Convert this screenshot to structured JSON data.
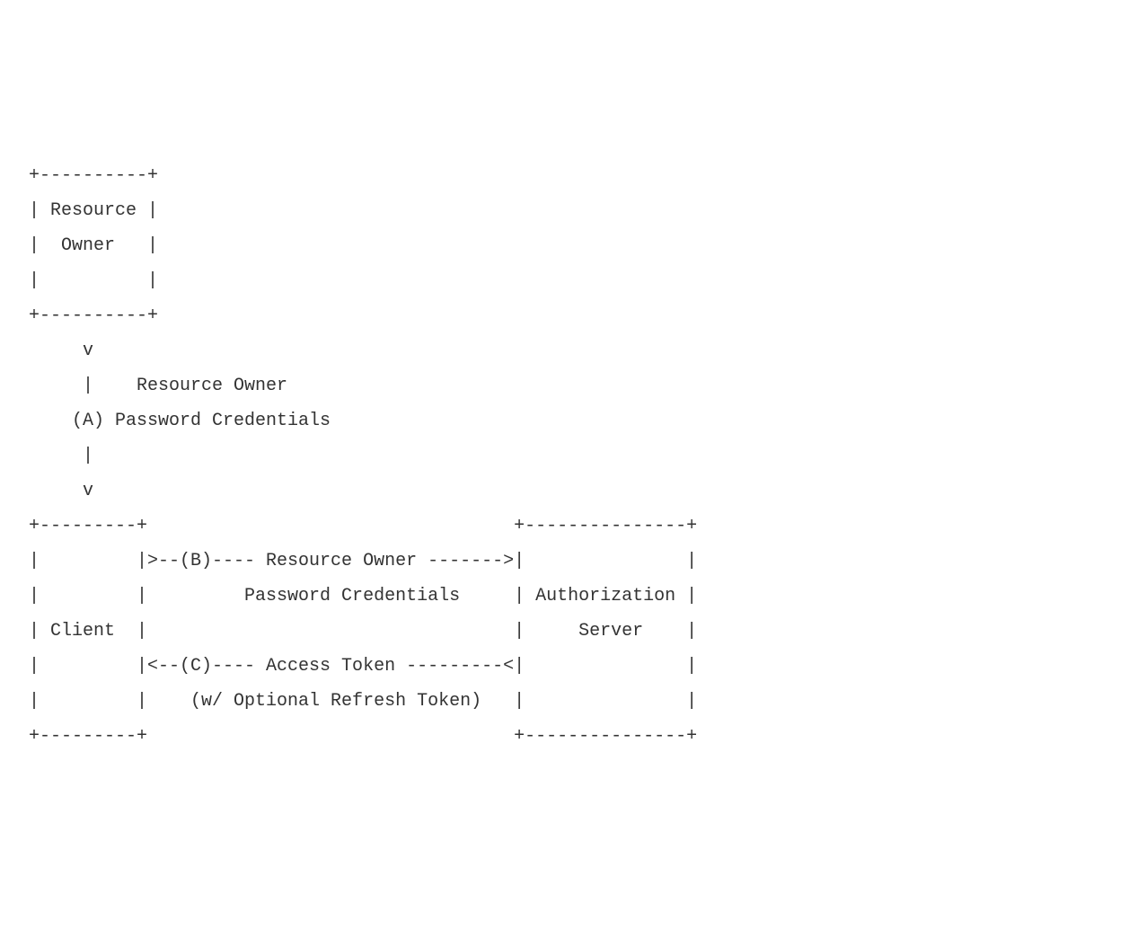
{
  "diagram": {
    "lines": [
      " +----------+",
      " | Resource |",
      " |  Owner   |",
      " |          |",
      " +----------+",
      "      v",
      "      |    Resource Owner",
      "     (A) Password Credentials",
      "      |",
      "      v",
      " +---------+                                  +---------------+",
      " |         |>--(B)---- Resource Owner ------->|               |",
      " |         |         Password Credentials     | Authorization |",
      " | Client  |                                  |     Server    |",
      " |         |<--(C)---- Access Token ---------<|               |",
      " |         |    (w/ Optional Refresh Token)   |               |",
      " +---------+                                  +---------------+"
    ]
  },
  "entities": {
    "resource_owner": "Resource Owner",
    "client": "Client",
    "authorization_server": "Authorization Server"
  },
  "flows": {
    "A": {
      "label": "(A)",
      "description": "Resource Owner Password Credentials",
      "from": "Resource Owner",
      "to": "Client"
    },
    "B": {
      "label": "(B)",
      "description": "Resource Owner Password Credentials",
      "from": "Client",
      "to": "Authorization Server"
    },
    "C": {
      "label": "(C)",
      "description": "Access Token (w/ Optional Refresh Token)",
      "from": "Authorization Server",
      "to": "Client"
    }
  }
}
